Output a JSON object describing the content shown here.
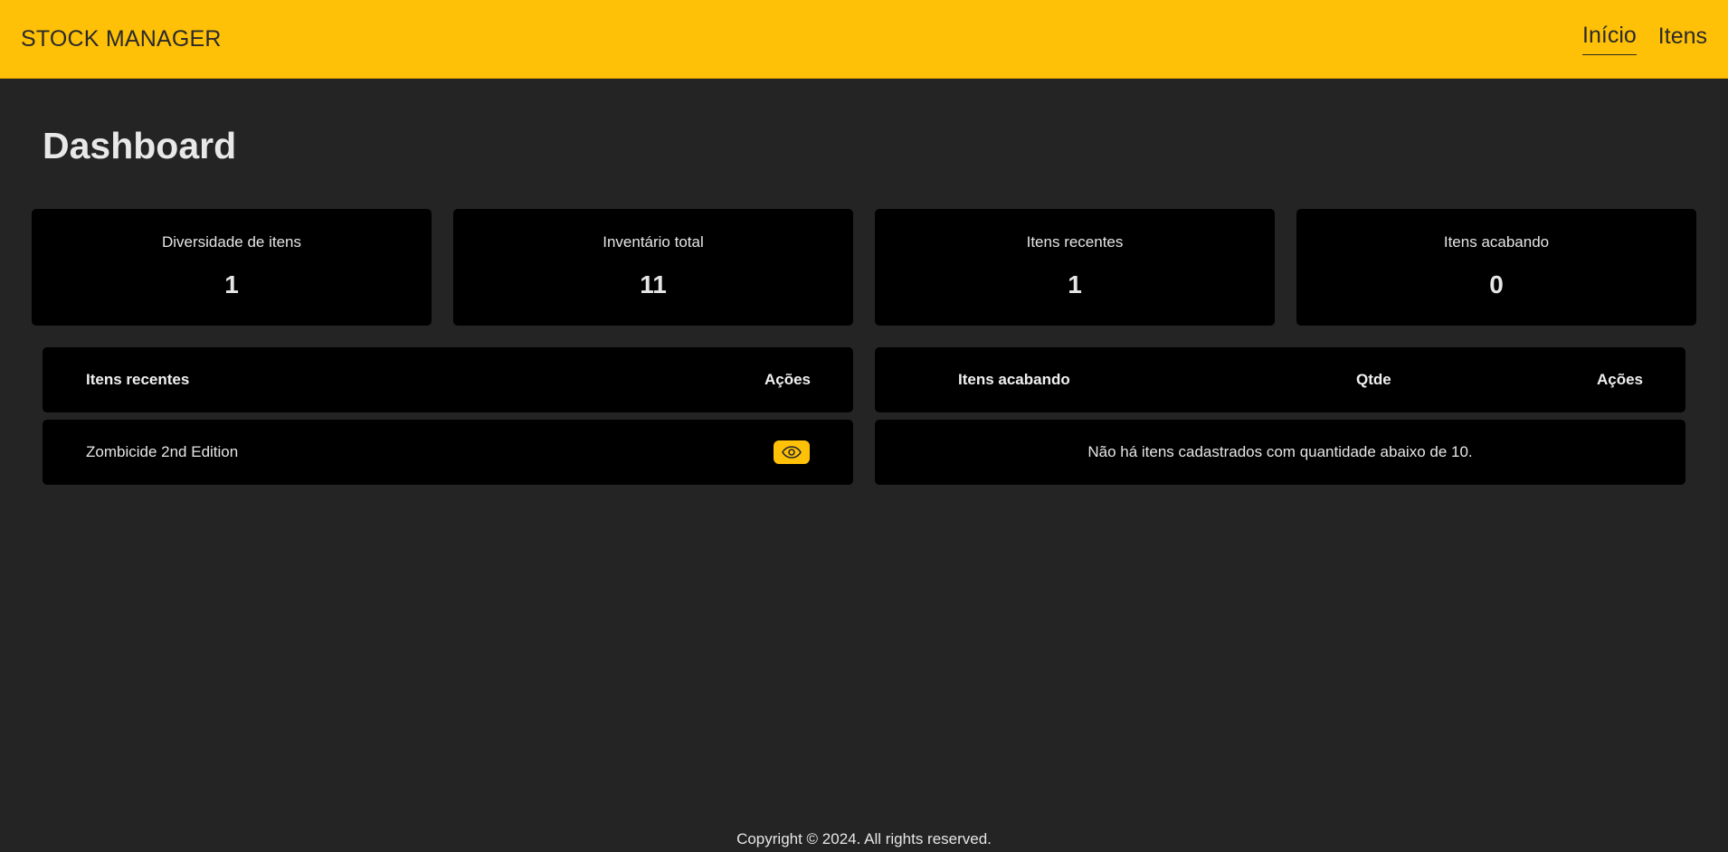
{
  "navbar": {
    "brand": "STOCK MANAGER",
    "links": [
      {
        "label": "Início",
        "active": true
      },
      {
        "label": "Itens",
        "active": false
      }
    ]
  },
  "page_title": "Dashboard",
  "stats": [
    {
      "label": "Diversidade de itens",
      "value": "1"
    },
    {
      "label": "Inventário total",
      "value": "11"
    },
    {
      "label": "Itens recentes",
      "value": "1"
    },
    {
      "label": "Itens acabando",
      "value": "0"
    }
  ],
  "recent_table": {
    "headers": {
      "name": "Itens recentes",
      "actions": "Ações"
    },
    "rows": [
      {
        "name": "Zombicide 2nd Edition",
        "action_icon": "eye-icon"
      }
    ]
  },
  "low_stock_table": {
    "headers": {
      "name": "Itens acabando",
      "qty": "Qtde",
      "actions": "Ações"
    },
    "empty_message": "Não há itens cadastrados com quantidade abaixo de 10."
  },
  "footer": {
    "copyright": "Copyright © 2024. All rights reserved."
  },
  "colors": {
    "accent": "#ffc107",
    "background": "#242424",
    "card": "#000000"
  }
}
